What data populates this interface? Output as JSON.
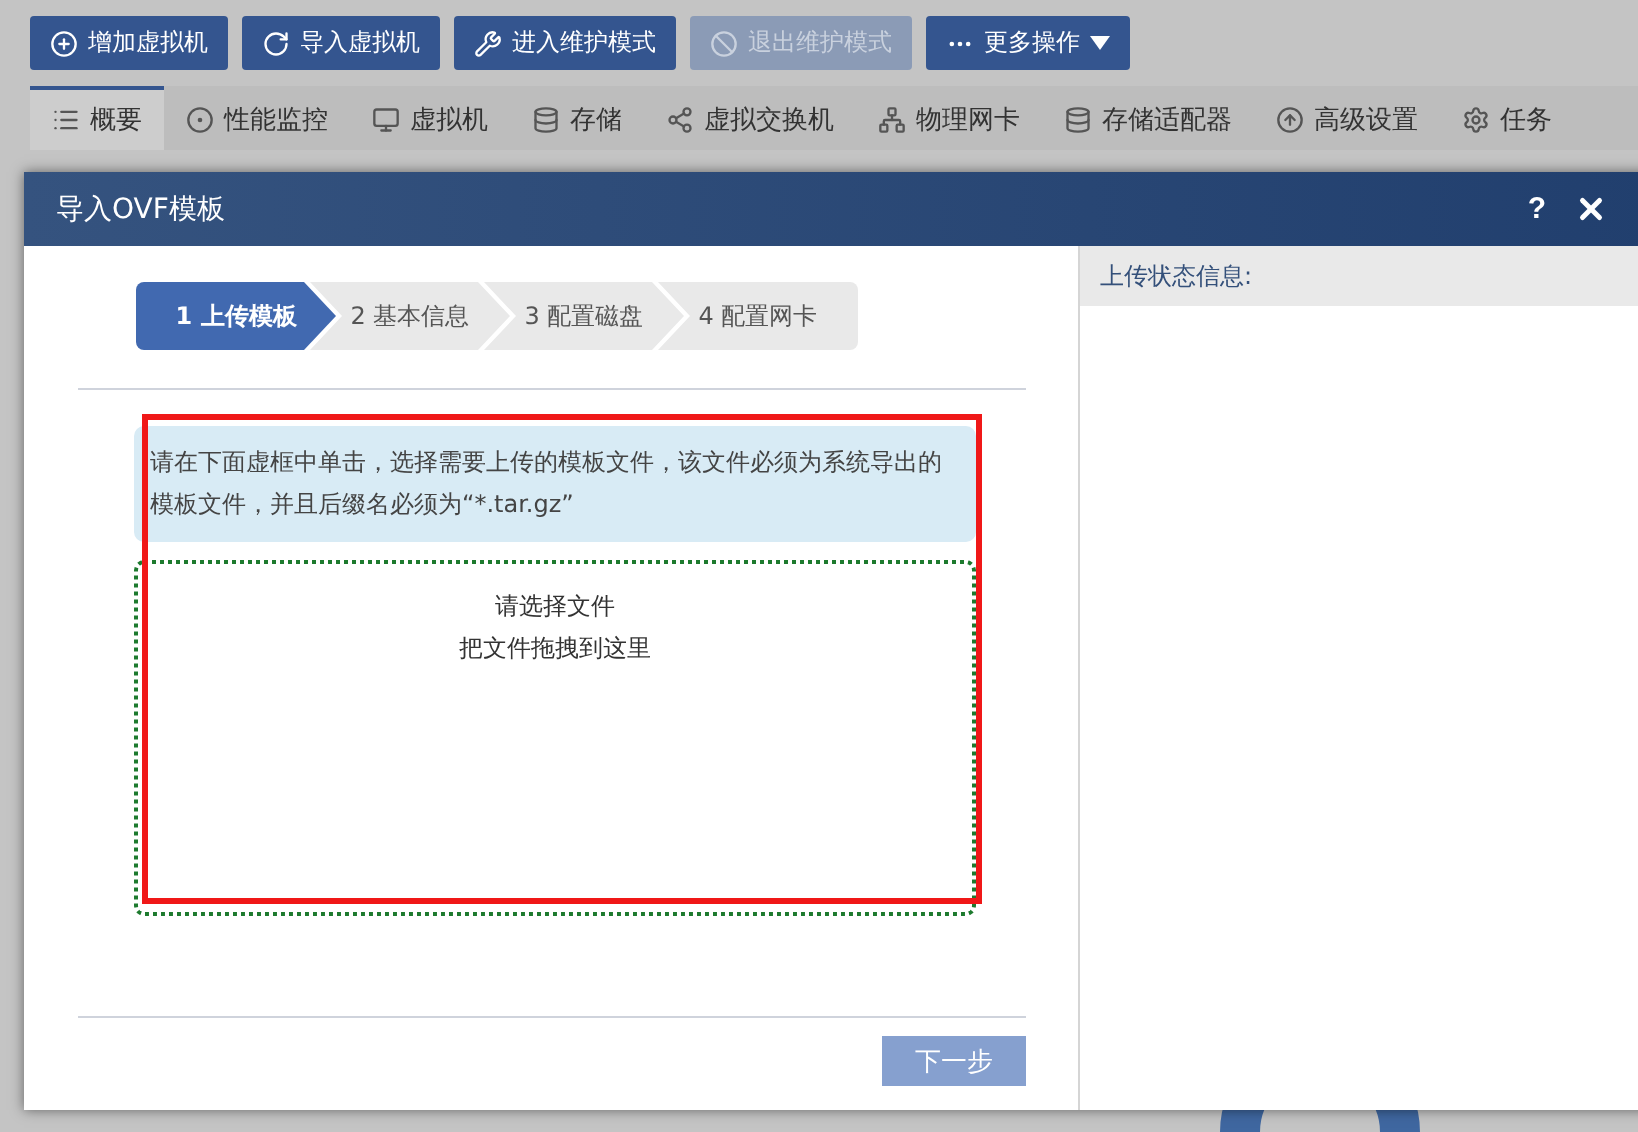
{
  "toolbar": [
    {
      "label": "增加虚拟机",
      "disabled": false
    },
    {
      "label": "导入虚拟机",
      "disabled": false
    },
    {
      "label": "进入维护模式",
      "disabled": false
    },
    {
      "label": "退出维护模式",
      "disabled": true
    },
    {
      "label": "更多操作",
      "disabled": false
    }
  ],
  "tabs": [
    {
      "label": "概要",
      "selected": true
    },
    {
      "label": "性能监控",
      "selected": false
    },
    {
      "label": "虚拟机",
      "selected": false
    },
    {
      "label": "存储",
      "selected": false
    },
    {
      "label": "虚拟交换机",
      "selected": false
    },
    {
      "label": "物理网卡",
      "selected": false
    },
    {
      "label": "存储适配器",
      "selected": false
    },
    {
      "label": "高级设置",
      "selected": false
    },
    {
      "label": "任务",
      "selected": false
    }
  ],
  "dialog": {
    "title": "导入OVF模板",
    "help": "?",
    "steps": [
      {
        "label": "1 上传模板",
        "selected": true
      },
      {
        "label": "2 基本信息",
        "selected": false
      },
      {
        "label": "3 配置磁盘",
        "selected": false
      },
      {
        "label": "4 配置网卡",
        "selected": false
      }
    ],
    "notice": "请在下面虚框中单击，选择需要上传的模板文件，该文件必须为系统导出的模板文件，并且后缀名必须为“*.tar.gz”",
    "dropzone": [
      "请选择文件",
      "把文件拖拽到这里"
    ],
    "next_button": {
      "label": "下一步",
      "disabled": true
    },
    "status_header": "上传状态信息:"
  }
}
